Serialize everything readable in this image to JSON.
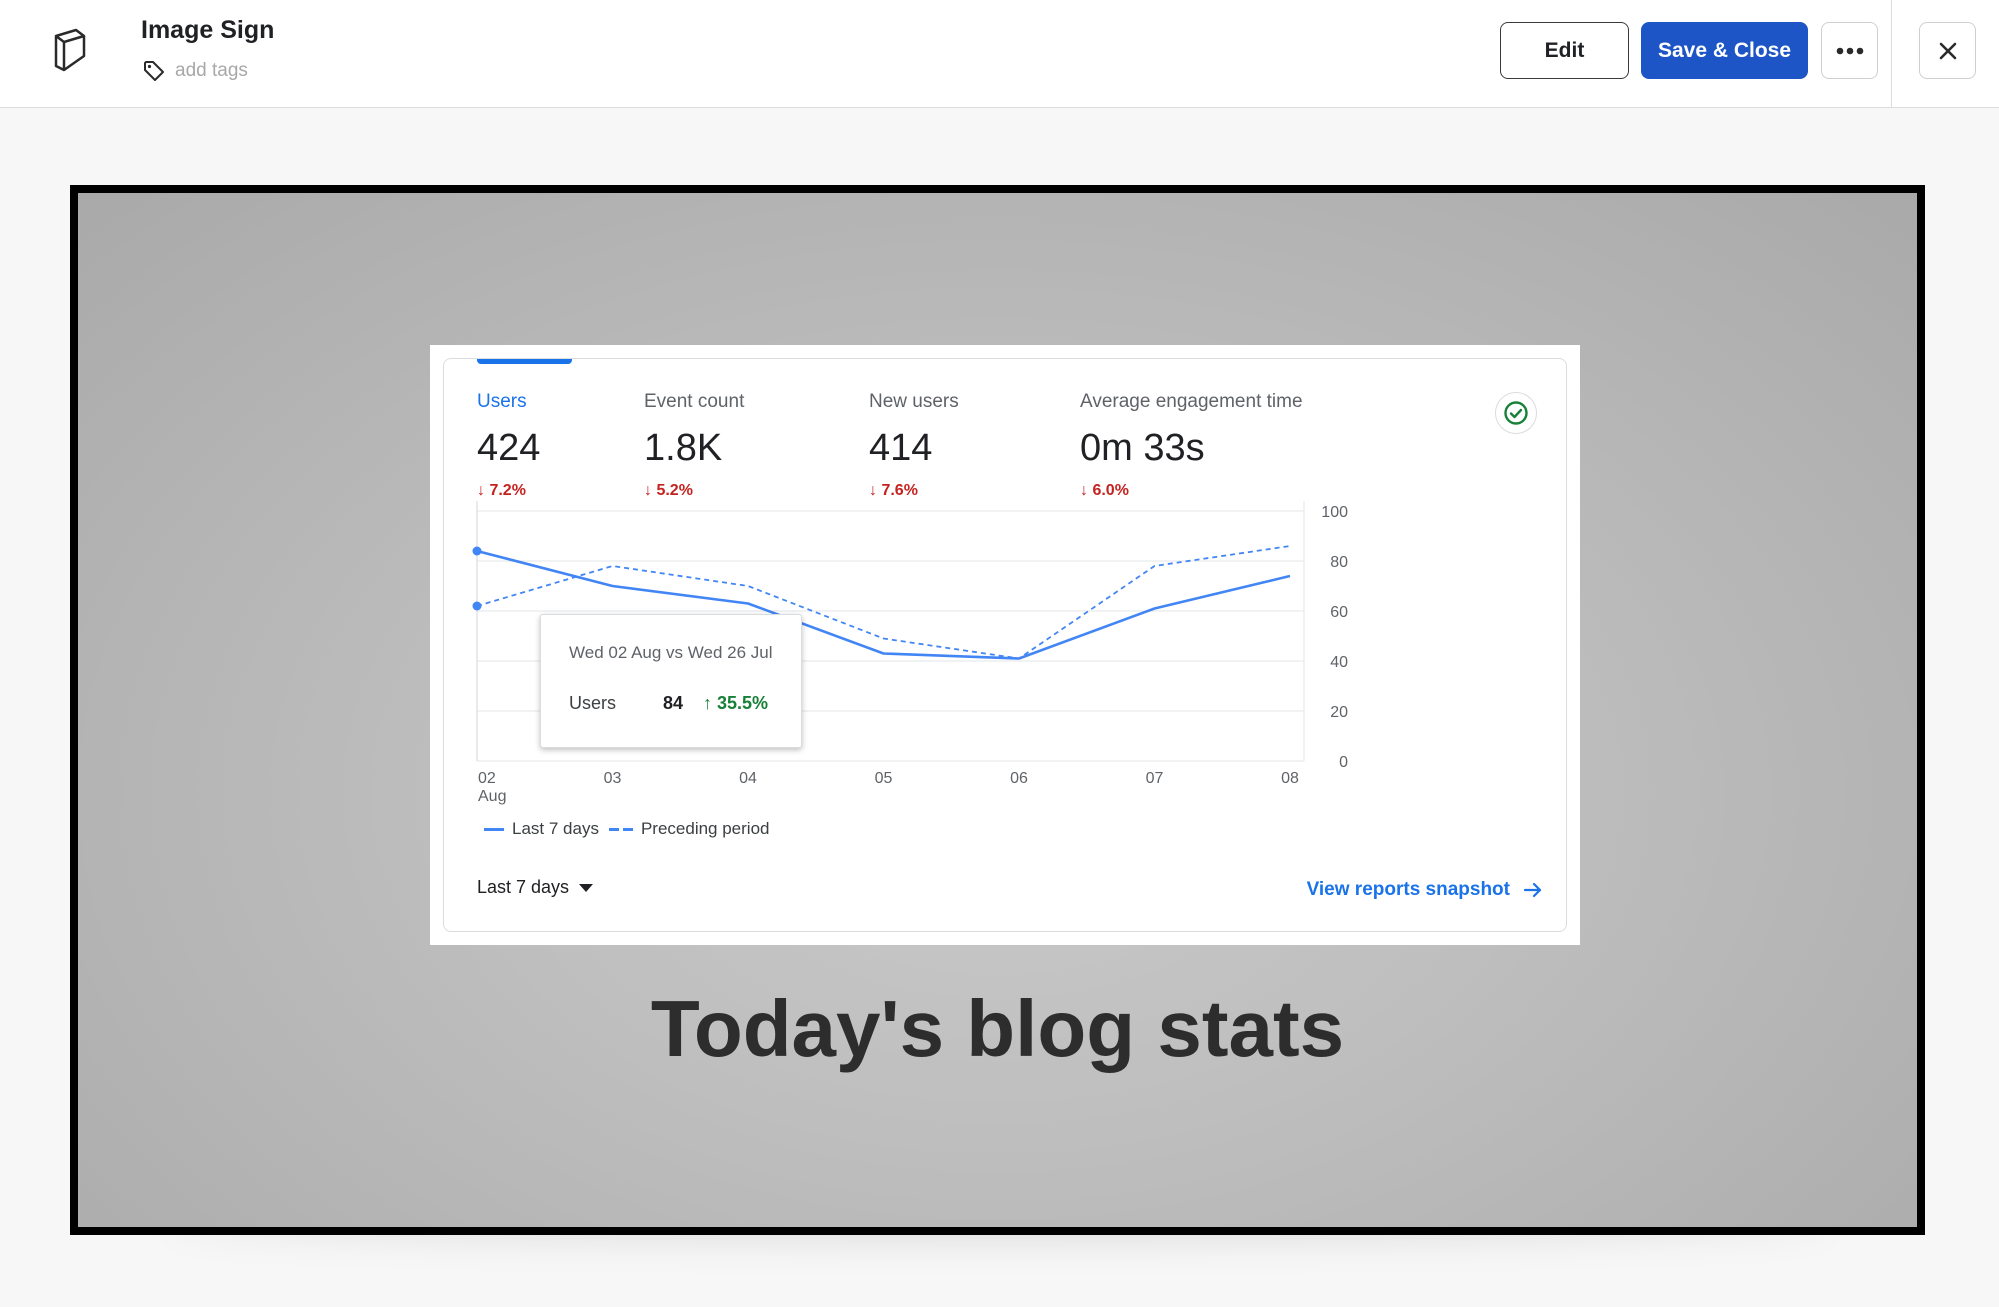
{
  "header": {
    "title": "Image Sign",
    "tags_placeholder": "add tags",
    "edit_label": "Edit",
    "save_label": "Save & Close"
  },
  "slide": {
    "headline": "Today's blog stats",
    "background_color": "#bdbdbd"
  },
  "analytics_card": {
    "metrics": [
      {
        "label": "Users",
        "value": "424",
        "change": "7.2%",
        "direction": "down"
      },
      {
        "label": "Event count",
        "value": "1.8K",
        "change": "5.2%",
        "direction": "down"
      },
      {
        "label": "New users",
        "value": "414",
        "change": "7.6%",
        "direction": "down"
      },
      {
        "label": "Average engagement time",
        "value": "0m 33s",
        "change": "6.0%",
        "direction": "down"
      }
    ],
    "tooltip": {
      "date": "Wed 02 Aug vs Wed 26 Jul",
      "metric": "Users",
      "value": "84",
      "change": "35.5%"
    },
    "date_range": "Last 7 days",
    "view_link": "View reports snapshot"
  },
  "chart_data": {
    "type": "line",
    "categories": [
      "02\nAug",
      "03",
      "04",
      "05",
      "06",
      "07",
      "08"
    ],
    "x_ticks": [
      {
        "line1": "02",
        "line2": "Aug"
      },
      {
        "line1": "03",
        "line2": ""
      },
      {
        "line1": "04",
        "line2": ""
      },
      {
        "line1": "05",
        "line2": ""
      },
      {
        "line1": "06",
        "line2": ""
      },
      {
        "line1": "07",
        "line2": ""
      },
      {
        "line1": "08",
        "line2": ""
      }
    ],
    "y_ticks": [
      "100",
      "80",
      "60",
      "40",
      "20",
      "0"
    ],
    "y_tick_values": [
      100,
      80,
      60,
      40,
      20,
      0
    ],
    "ylim": [
      0,
      100
    ],
    "y_axis_side": "right",
    "grid": true,
    "series": [
      {
        "name": "Last 7 days",
        "style": "solid",
        "values": [
          84,
          70,
          63,
          43,
          41,
          61,
          74
        ],
        "color": "#4285f4"
      },
      {
        "name": "Preceding period",
        "style": "dashed",
        "values": [
          62,
          78,
          70,
          49,
          41,
          78,
          86
        ],
        "color": "#4285f4"
      }
    ],
    "legend_position": "bottom-left"
  },
  "icons": {
    "logo": "logo-icon",
    "tag": "tag-icon",
    "more": "more-icon",
    "close": "close-icon",
    "check": "check-circle-icon",
    "arrow": "arrow-right-icon"
  },
  "colors": {
    "primary_button": "#1d55c6",
    "analytics_blue": "#1a73e8",
    "decrease_red": "#c5221f",
    "increase_green": "#188038"
  }
}
